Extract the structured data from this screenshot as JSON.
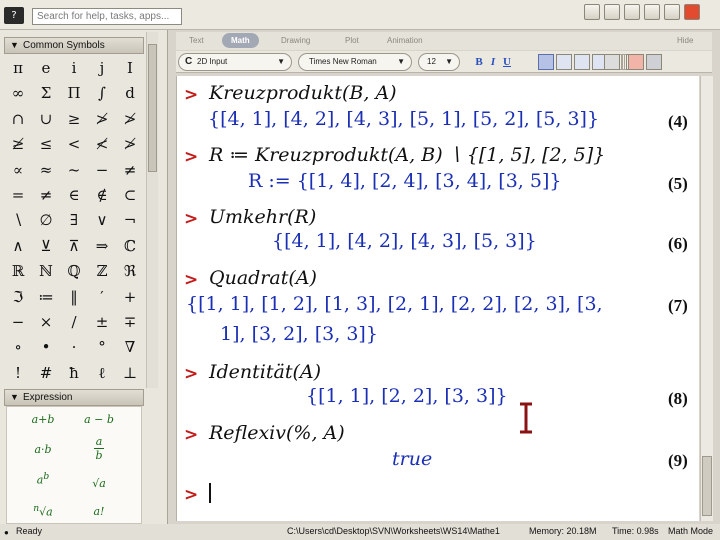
{
  "help_search": {
    "placeholder": "Search for help, tasks, apps..."
  },
  "palettes": {
    "common_symbols": {
      "header": "Common Symbols",
      "symbols": [
        "π",
        "e",
        "i",
        "j",
        "I",
        "∞",
        "Σ",
        "Π",
        "∫",
        "d",
        "∩",
        "∪",
        "≥",
        "≯",
        "≯",
        "≱",
        "≤",
        "<",
        "≮",
        "≯",
        "∝",
        "≈",
        "~",
        "−",
        "≠",
        "=",
        "≠",
        "∈",
        "∉",
        "⊂",
        "∖",
        "∅",
        "∃",
        "∨",
        "¬",
        "∧",
        "⊻",
        "⊼",
        "⇒",
        "ℂ",
        "ℝ",
        "ℕ",
        "ℚ",
        "ℤ",
        "ℜ",
        "ℑ",
        "≔",
        "‖",
        "′",
        "+",
        "−",
        "×",
        "/",
        "±",
        "∓",
        "∘",
        "•",
        "·",
        "°",
        "∇",
        "!",
        "#",
        "ħ",
        "ℓ",
        "⊥"
      ]
    },
    "expression": {
      "header": "Expression",
      "items": [
        "a+b",
        "a − b",
        "a·b",
        "a",
        "b",
        "a",
        "b",
        "√a",
        "n",
        "a",
        "a!"
      ]
    }
  },
  "tabs": [
    "Text",
    "Math",
    "Drawing",
    "Plot",
    "Animation"
  ],
  "hide_label": "Hide",
  "format": {
    "input_mode": "2D Input",
    "input_prefix": "C",
    "font": "Times New Roman",
    "size": "12",
    "bold": "B",
    "italic": "I",
    "underline": "U"
  },
  "worksheet": {
    "prompt": ">",
    "groups": [
      {
        "input": "Kreuzprodukt(B, A)",
        "output": "{[4, 1], [4, 2], [4, 3], [5, 1], [5, 2], [5, 3]}",
        "label": "(4)"
      },
      {
        "input": "R ≔ Kreuzprodukt(A, B) ∖ {[1, 5], [2, 5]}",
        "output": "R := {[1, 4], [2, 4], [3, 4], [3, 5]}",
        "label": "(5)"
      },
      {
        "input": "Umkehr(R)",
        "output": "{[4, 1], [4, 2], [4, 3], [5, 3]}",
        "label": "(6)"
      },
      {
        "input": "Quadrat(A)",
        "output": "{[1, 1], [1, 2], [1, 3], [2, 1], [2, 2], [2, 3], [3,",
        "output_cont": "1], [3, 2], [3, 3]}",
        "label": "(7)"
      },
      {
        "input": "Identität(A)",
        "output": "{[1, 1], [2, 2], [3, 3]}",
        "label": "(8)"
      },
      {
        "input": "Reflexiv(%, A)",
        "output": "true",
        "label": "(9)"
      }
    ]
  },
  "status": {
    "ready": "Ready",
    "path": "C:\\Users\\cd\\Desktop\\SVN\\Worksheets\\WS14\\Mathe1",
    "memory": "Memory: 20.18M",
    "time": "Time: 0.98s",
    "mode": "Math Mode"
  },
  "colors": {
    "prompt": "#c41a1a",
    "output": "#1a2fb5",
    "active_tab": "#a2a8b4"
  }
}
